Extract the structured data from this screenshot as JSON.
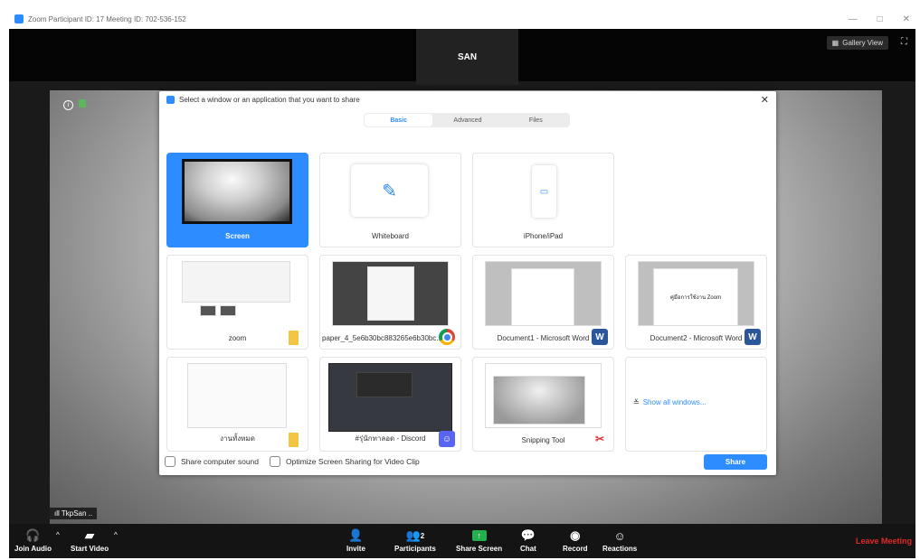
{
  "window": {
    "title": "Zoom Participant ID: 17   Meeting ID: 702-536-152",
    "controls": [
      "—",
      "□",
      "✕"
    ]
  },
  "top": {
    "speaker_name": "SAN",
    "gallery_view_label": "Gallery View"
  },
  "participant_tag": "TkpSan ..",
  "dialog": {
    "title": "Select a window or an application that you want to share",
    "tabs": [
      {
        "label": "Basic",
        "active": true
      },
      {
        "label": "Advanced",
        "active": false
      },
      {
        "label": "Files",
        "active": false
      }
    ],
    "tiles": [
      {
        "label": "Screen",
        "selected": true
      },
      {
        "label": "Whiteboard"
      },
      {
        "label": "iPhone/iPad"
      },
      {
        "label": "zoom",
        "badge": "folder-icon"
      },
      {
        "label": "paper_4_5e6b30bc883265e6b30bc...",
        "badge": "chrome-icon"
      },
      {
        "label": "Document1 - Microsoft Word",
        "badge": "word-icon"
      },
      {
        "label": "Document2 - Microsoft Word",
        "badge": "word-icon",
        "doc_text": "คู่มือการใช้งาน Zoom"
      },
      {
        "label": "งานทั้งหมด",
        "badge": "folder-icon"
      },
      {
        "label": "#รุ่นักทาลอด - Discord",
        "badge": "discord-icon"
      },
      {
        "label": "Snipping Tool",
        "badge": "snipping-icon"
      }
    ],
    "show_all": "Show all windows...",
    "share_sound": "Share computer sound",
    "optimize": "Optimize Screen Sharing for Video Clip",
    "share_button": "Share"
  },
  "toolbar": {
    "join_audio": "Join Audio",
    "start_video": "Start Video",
    "invite": "Invite",
    "participants": "Participants",
    "participant_count": "2",
    "share_screen": "Share Screen",
    "chat": "Chat",
    "record": "Record",
    "reactions": "Reactions",
    "leave": "Leave Meeting"
  },
  "colors": {
    "accent": "#2d8cff",
    "leave": "#e02828",
    "share_screen_green": "#23b14d"
  }
}
